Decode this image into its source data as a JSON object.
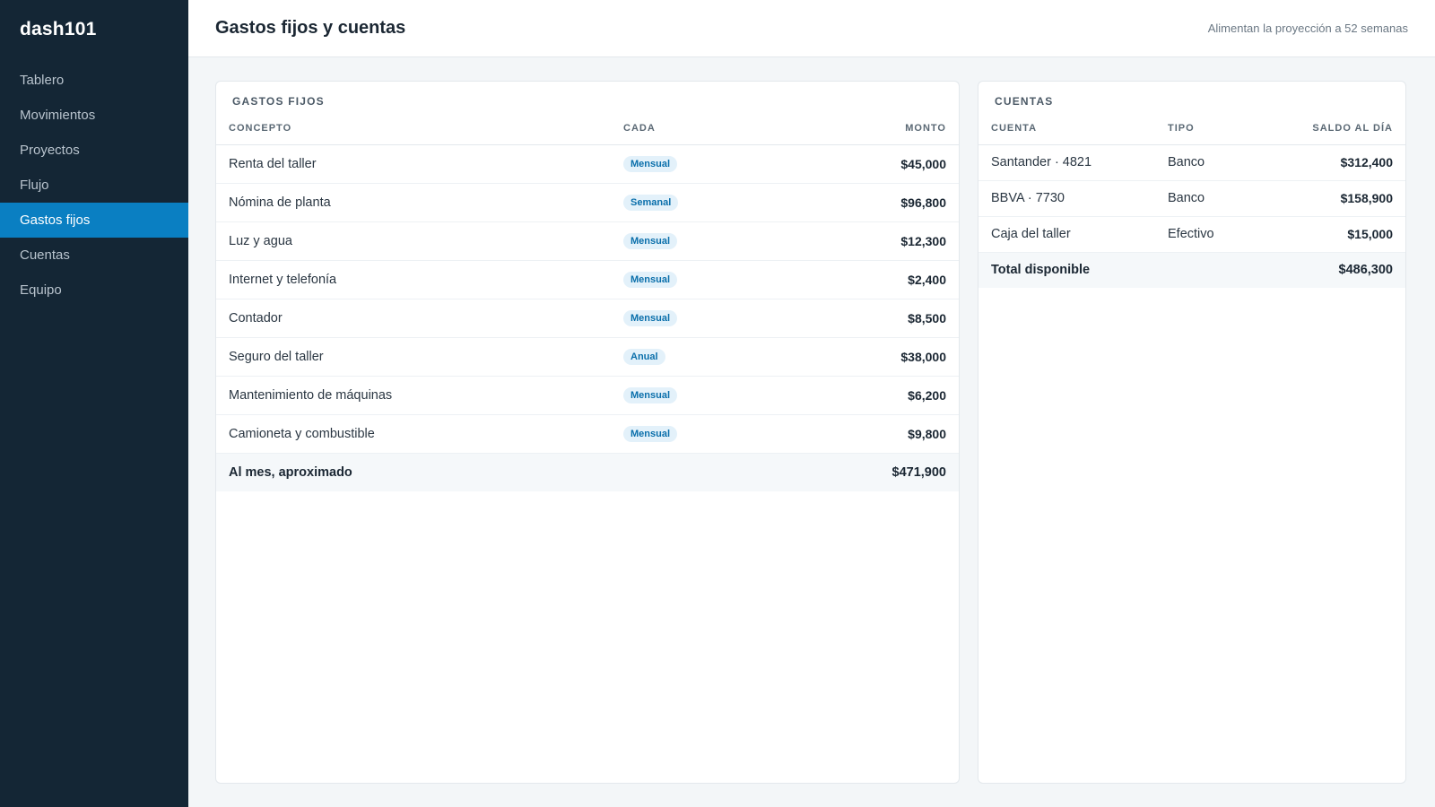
{
  "app": {
    "brand": "dash101"
  },
  "sidebar": {
    "items": [
      {
        "label": "Tablero",
        "active": false
      },
      {
        "label": "Movimientos",
        "active": false
      },
      {
        "label": "Proyectos",
        "active": false
      },
      {
        "label": "Flujo",
        "active": false
      },
      {
        "label": "Gastos fijos",
        "active": true
      },
      {
        "label": "Cuentas",
        "active": false
      },
      {
        "label": "Equipo",
        "active": false
      }
    ]
  },
  "header": {
    "title": "Gastos fijos y cuentas",
    "subtitle": "Alimentan la proyección a 52 semanas"
  },
  "fixed_expenses": {
    "title": "GASTOS FIJOS",
    "columns": [
      "CONCEPTO",
      "CADA",
      "MONTO"
    ],
    "rows": [
      {
        "concept": "Renta del taller",
        "frequency": "Mensual",
        "amount": "$45,000"
      },
      {
        "concept": "Nómina de planta",
        "frequency": "Semanal",
        "amount": "$96,800"
      },
      {
        "concept": "Luz y agua",
        "frequency": "Mensual",
        "amount": "$12,300"
      },
      {
        "concept": "Internet y telefonía",
        "frequency": "Mensual",
        "amount": "$2,400"
      },
      {
        "concept": "Contador",
        "frequency": "Mensual",
        "amount": "$8,500"
      },
      {
        "concept": "Seguro del taller",
        "frequency": "Anual",
        "amount": "$38,000"
      },
      {
        "concept": "Mantenimiento de máquinas",
        "frequency": "Mensual",
        "amount": "$6,200"
      },
      {
        "concept": "Camioneta y combustible",
        "frequency": "Mensual",
        "amount": "$9,800"
      }
    ],
    "total_label": "Al mes, aproximado",
    "total_amount": "$471,900"
  },
  "accounts": {
    "title": "CUENTAS",
    "columns": [
      "CUENTA",
      "TIPO",
      "SALDO AL DÍA"
    ],
    "rows": [
      {
        "name": "Santander · 4821",
        "type": "Banco",
        "balance": "$312,400"
      },
      {
        "name": "BBVA · 7730",
        "type": "Banco",
        "balance": "$158,900"
      },
      {
        "name": "Caja del taller",
        "type": "Efectivo",
        "balance": "$15,000"
      }
    ],
    "total_label": "Total disponible",
    "total_amount": "$486,300"
  },
  "colors": {
    "sidebar_bg": "#142635",
    "accent": "#0a7fc2",
    "page_bg": "#f3f6f8"
  }
}
